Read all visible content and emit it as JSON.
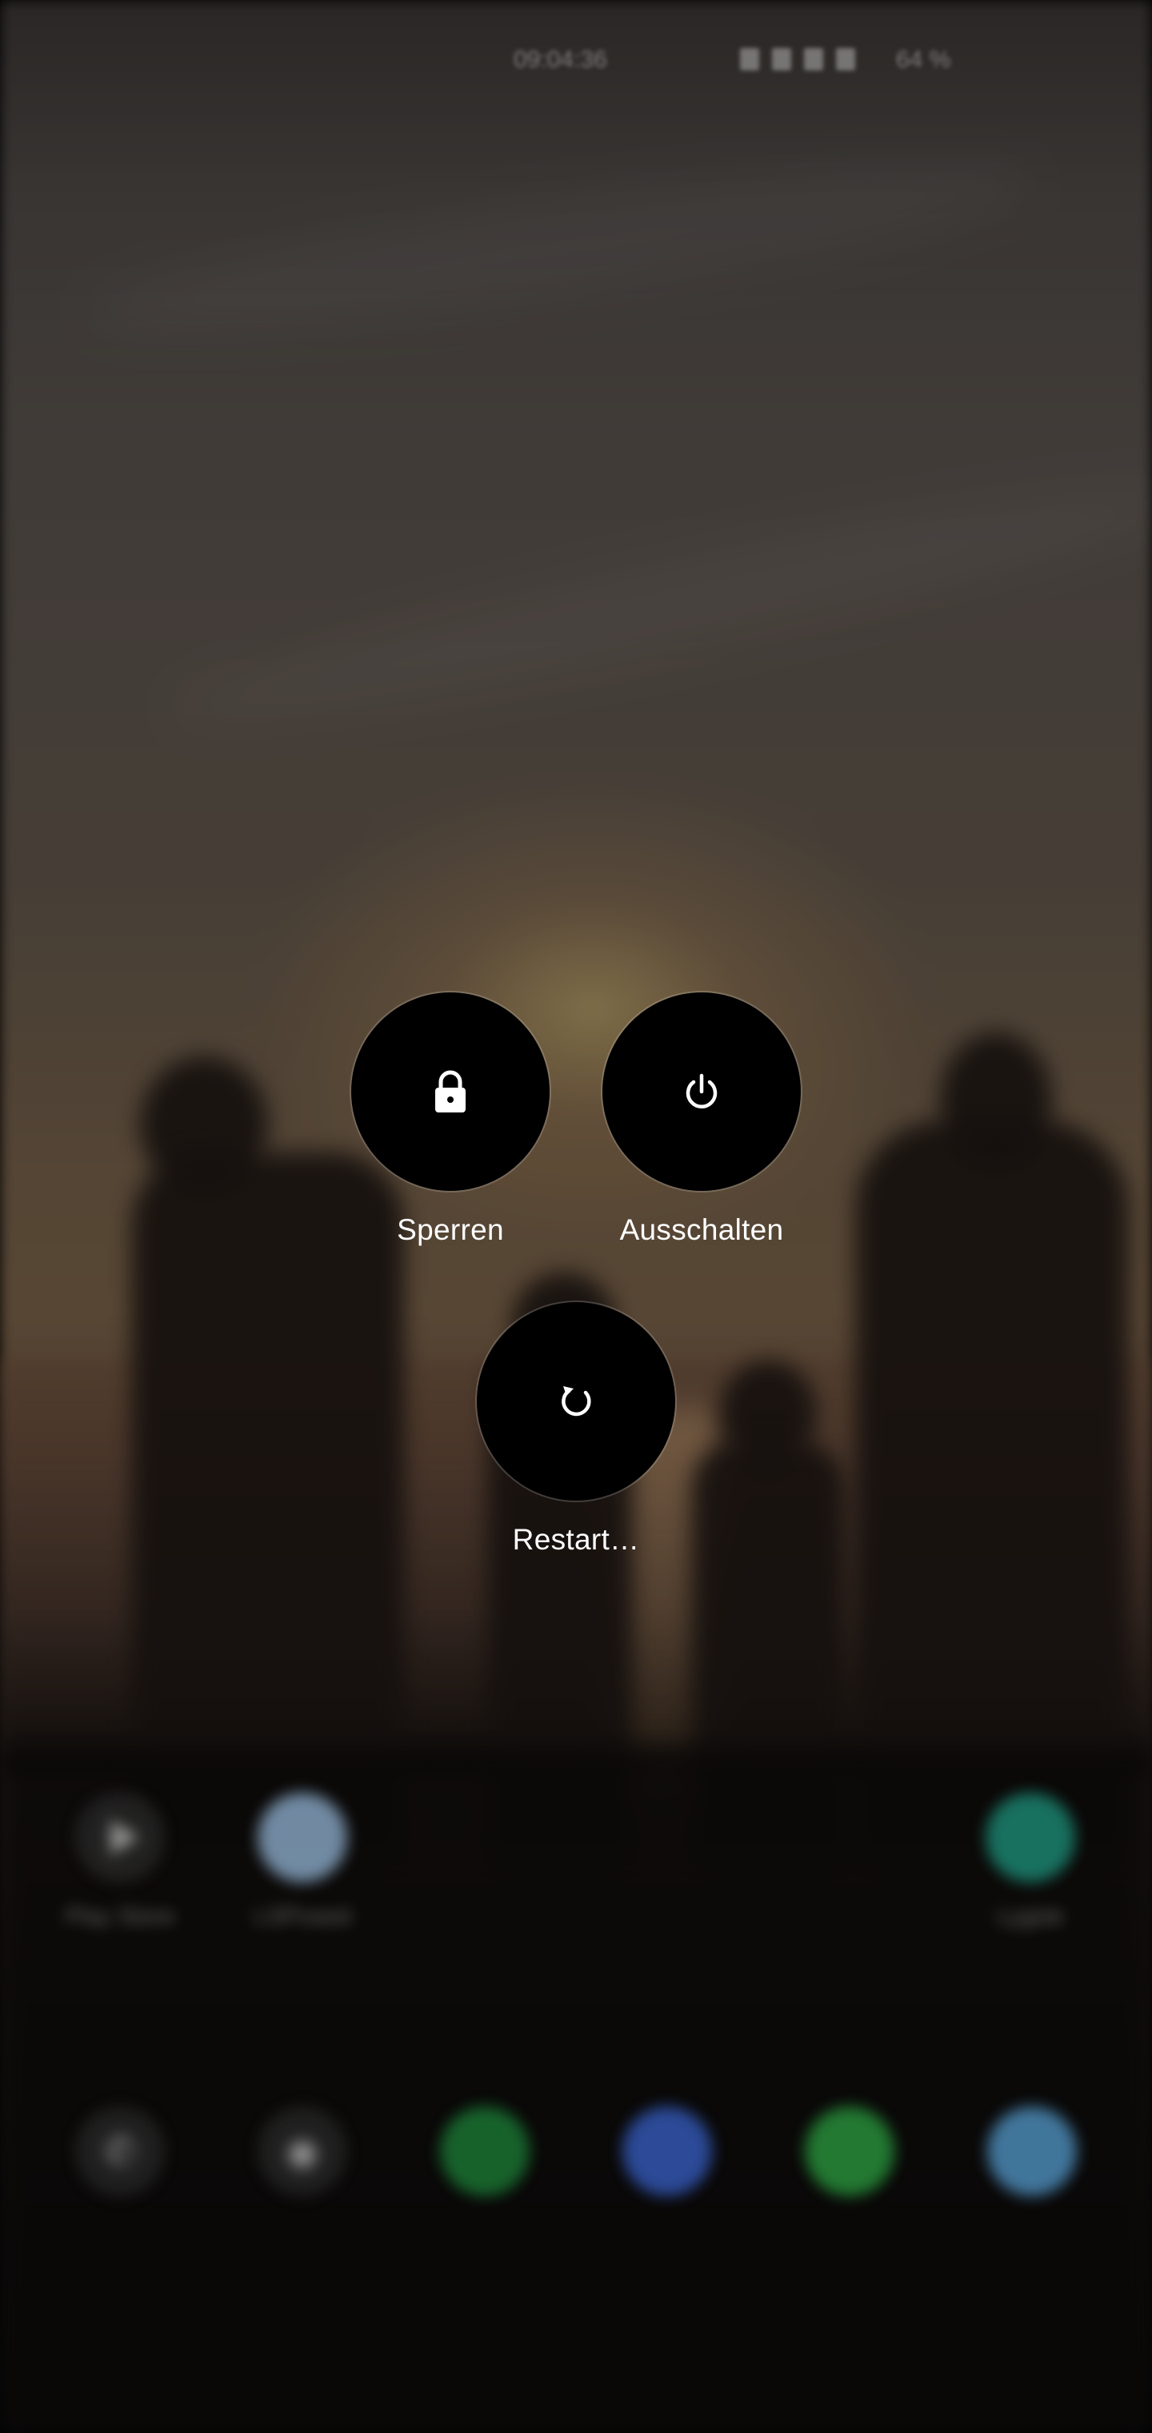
{
  "status_bar": {
    "time": "09:04:36",
    "battery": "64 %",
    "icons": [
      "mute-icon",
      "wifi-icon",
      "data-icon",
      "signal-icon"
    ]
  },
  "power_menu": {
    "lock": {
      "label": "Sperren",
      "icon": "lock-icon"
    },
    "power_off": {
      "label": "Ausschalten",
      "icon": "power-icon"
    },
    "restart": {
      "label": "Restart…",
      "icon": "restart-icon"
    }
  },
  "home_apps": [
    {
      "label": "Play Store",
      "icon": "play-store-icon",
      "color": "#2b2b2b"
    },
    {
      "label": "LSPosed",
      "icon": "lsposed-icon",
      "color": "#9ec3e6"
    },
    {
      "label": "Lygisk",
      "icon": "lygisk-icon",
      "color": "#1f9e86"
    }
  ],
  "dock": [
    {
      "icon": "phone-icon",
      "color": "#2a2a2a"
    },
    {
      "icon": "camera-icon",
      "color": "#2a2a2a"
    },
    {
      "icon": "spotify-icon",
      "color": "#1e8a3c"
    },
    {
      "icon": "messages-icon",
      "color": "#3b67d6"
    },
    {
      "icon": "whatsapp-icon",
      "color": "#2eaa45"
    },
    {
      "icon": "telegram-icon",
      "color": "#5aa6dc"
    }
  ],
  "colors": {
    "button_fill": "#000000",
    "label_text": "#ffffff"
  }
}
